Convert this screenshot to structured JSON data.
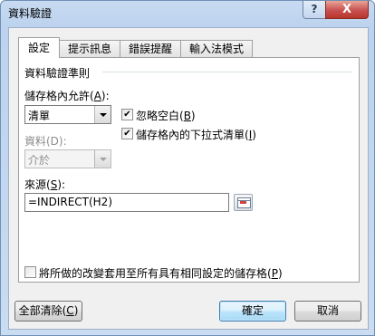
{
  "window": {
    "title": "資料驗證",
    "help_label": "?",
    "close_label": "X"
  },
  "tabs": [
    {
      "label": "設定",
      "active": true
    },
    {
      "label": "提示訊息",
      "active": false
    },
    {
      "label": "錯誤提醒",
      "active": false
    },
    {
      "label": "輸入法模式",
      "active": false
    }
  ],
  "criteria": {
    "group_label": "資料驗證準則",
    "allow_label": "儲存格內允許(",
    "allow_key": "A",
    "allow_tail": "):",
    "allow_value": "清單",
    "data_label": "資料(D):",
    "data_value": "介於",
    "ignore_blank_label": "忽略空白(",
    "ignore_blank_key": "B",
    "ignore_blank_tail": ")",
    "ignore_blank_checked": "✔",
    "dropdown_label": "儲存格內的下拉式清單(",
    "dropdown_key": "I",
    "dropdown_tail": ")",
    "dropdown_checked": "✔",
    "source_label": "來源(",
    "source_key": "S",
    "source_tail": "):",
    "source_value": "=INDIRECT(H2)",
    "collapse_icon": "range-select-icon"
  },
  "apply_all": {
    "label": "將所做的改變套用至所有具有相同設定的儲存格(",
    "key": "P",
    "tail": ")",
    "checked": ""
  },
  "buttons": {
    "clear_all": "全部清除(",
    "clear_all_key": "C",
    "clear_all_tail": ")",
    "ok": "確定",
    "cancel": "取消"
  },
  "colors": {
    "title_bar": "#bcd2ee",
    "close_button": "#c75050",
    "default_button_border": "#3c7fb1"
  }
}
